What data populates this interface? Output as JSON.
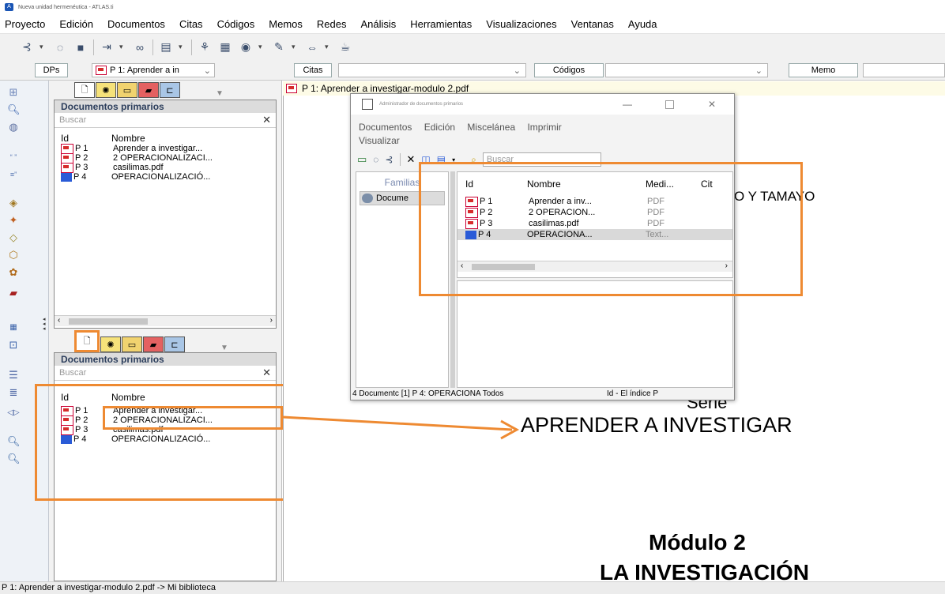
{
  "window": {
    "title": "Nueva unidad hermenéutica - ATLAS.ti",
    "logo": "ATLAS.ti logo"
  },
  "menu": [
    "Proyecto",
    "Edición",
    "Documentos",
    "Citas",
    "Códigos",
    "Memos",
    "Redes",
    "Análisis",
    "Herramientas",
    "Visualizaciones",
    "Ventanas",
    "Ayuda"
  ],
  "toolbar2": {
    "dps_label": "DPs",
    "doc_combo": "P 1: Aprender a in",
    "citas_label": "Citas",
    "codigos_label": "Códigos",
    "memo_label": "Memo"
  },
  "panel": {
    "title": "Documentos primarios",
    "search_placeholder": "Buscar",
    "col_id": "Id",
    "col_name": "Nombre",
    "rows": [
      {
        "id": "P 1",
        "name": "Aprender a investigar...",
        "type": "pdf"
      },
      {
        "id": "P 2",
        "name": "2 OPERACIONALIZACI...",
        "type": "pdf"
      },
      {
        "id": "P 3",
        "name": "casilimas.pdf",
        "type": "pdf"
      },
      {
        "id": "P 4",
        "name": "OPERACIONALIZACIÓ...",
        "type": "txt"
      }
    ]
  },
  "doc": {
    "tab_title": "P 1: Aprender a investigar-modulo 2.pdf",
    "text_fragment": "O Y TAMAYO",
    "serie": "Serie",
    "heading": "APRENDER A INVESTIGAR",
    "modulo": "Módulo 2",
    "modulo_title": "LA INVESTIGACIÓN"
  },
  "dialog": {
    "title": "Administrador de documentos primarios",
    "menu": [
      "Documentos",
      "Edición",
      "Miscelánea",
      "Imprimir",
      "Visualizar"
    ],
    "search_placeholder": "Buscar",
    "families_label": "Familias",
    "families_item": "Docume",
    "columns": [
      "Id",
      "Nombre",
      "Medi...",
      "Cit"
    ],
    "rows": [
      {
        "id": "P 1",
        "name": "Aprender a inv...",
        "media": "PDF",
        "type": "pdf"
      },
      {
        "id": "P 2",
        "name": "2 OPERACION...",
        "media": "PDF",
        "type": "pdf"
      },
      {
        "id": "P 3",
        "name": "casilimas.pdf",
        "media": "PDF",
        "type": "pdf"
      },
      {
        "id": "P 4",
        "name": "OPERACIONA...",
        "media": "Text...",
        "type": "txt"
      }
    ],
    "status_left": "4 Documentc [1] P 4: OPERACIONA Todos",
    "status_right": "Id - El índice P"
  },
  "status": {
    "text": "P 1: Aprender a investigar-modulo 2.pdf -> Mi biblioteca"
  },
  "colors": {
    "accent": "#ee8a32"
  }
}
